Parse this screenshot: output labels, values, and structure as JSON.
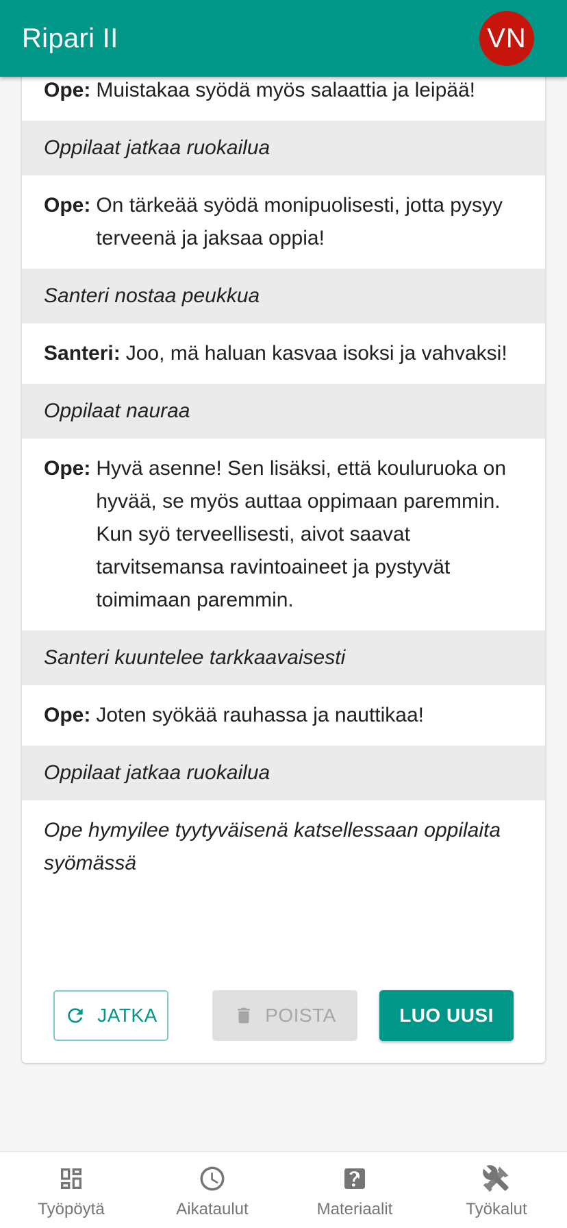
{
  "app": {
    "title": "Ripari II",
    "user_initials": "VN"
  },
  "script": {
    "lines": [
      {
        "type": "speech",
        "speaker": "Ope:",
        "text": "Muistakaa syödä myös salaattia ja leipää!"
      },
      {
        "type": "action",
        "text": "Oppilaat jatkaa ruokailua"
      },
      {
        "type": "speech",
        "speaker": "Ope:",
        "text": "On tärkeää syödä monipuolisesti, jotta pysyy terveenä ja jaksaa oppia!"
      },
      {
        "type": "action",
        "text": "Santeri nostaa peukkua"
      },
      {
        "type": "speech",
        "speaker": "Santeri:",
        "text": "Joo, mä haluan kasvaa isoksi ja vahvaksi!"
      },
      {
        "type": "action",
        "text": "Oppilaat nauraa"
      },
      {
        "type": "speech",
        "speaker": "Ope:",
        "text": "Hyvä asenne! Sen lisäksi, että kouluruoka on hyvää, se myös auttaa oppimaan paremmin. Kun syö terveellisesti, aivot saavat tarvitsemansa ravintoaineet ja pystyvät toimimaan paremmin."
      },
      {
        "type": "action",
        "text": "Santeri kuuntelee tarkkaavaisesti"
      },
      {
        "type": "speech",
        "speaker": "Ope:",
        "text": "Joten syökää rauhassa ja nauttikaa!"
      },
      {
        "type": "action",
        "text": "Oppilaat jatkaa ruokailua"
      },
      {
        "type": "narration",
        "text": "Ope hymyilee tyytyväisenä katsellessaan oppilaita syömässä"
      }
    ]
  },
  "actions": {
    "continue_label": "JATKA",
    "delete_label": "POISTA",
    "create_label": "LUO UUSI"
  },
  "nav": {
    "items": [
      {
        "label": "Työpöytä",
        "icon": "dashboard-icon"
      },
      {
        "label": "Aikataulut",
        "icon": "clock-icon"
      },
      {
        "label": "Materiaalit",
        "icon": "help-box-icon"
      },
      {
        "label": "Työkalut",
        "icon": "tools-icon"
      }
    ]
  },
  "colors": {
    "primary": "#009688",
    "avatar": "#c6160b",
    "action_bg": "#ebebeb",
    "disabled_bg": "#e0e0e0",
    "nav_text": "#757575"
  }
}
